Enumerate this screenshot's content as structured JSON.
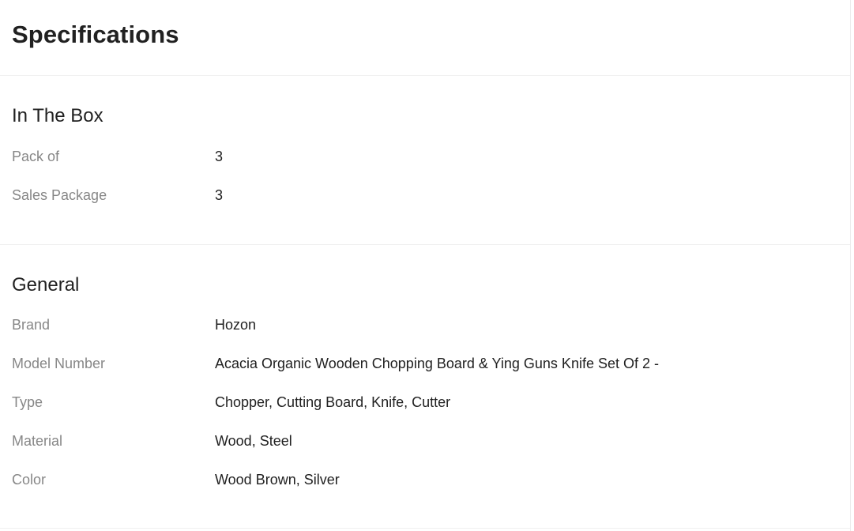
{
  "header": {
    "title": "Specifications"
  },
  "sections": [
    {
      "title": "In The Box",
      "rows": [
        {
          "label": "Pack of",
          "value": "3"
        },
        {
          "label": "Sales Package",
          "value": "3"
        }
      ]
    },
    {
      "title": "General",
      "rows": [
        {
          "label": "Brand",
          "value": "Hozon"
        },
        {
          "label": "Model Number",
          "value": "Acacia Organic Wooden Chopping Board & Ying Guns Knife Set Of 2 -"
        },
        {
          "label": "Type",
          "value": "Chopper, Cutting Board, Knife, Cutter"
        },
        {
          "label": "Material",
          "value": "Wood, Steel"
        },
        {
          "label": "Color",
          "value": "Wood Brown, Silver"
        }
      ]
    }
  ]
}
